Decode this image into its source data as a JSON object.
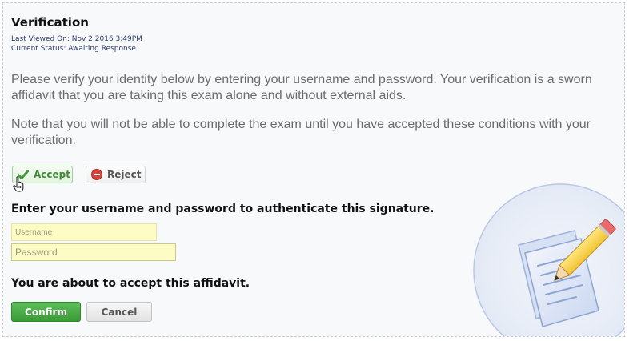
{
  "verification": {
    "title": "Verification",
    "last_viewed": "Last Viewed On: Nov 2 2016 3:49PM",
    "status": "Current Status: Awaiting Response",
    "paragraph1": "Please verify your identity below by entering your username and password. Your verification is a sworn affidavit that you are taking this exam alone and without external aids.",
    "paragraph2": "Note that you will not be able to complete the exam until you have accepted these conditions with your verification."
  },
  "decision": {
    "accept_label": "Accept",
    "reject_label": "Reject"
  },
  "auth": {
    "instruction": "Enter your username and password to authenticate this signature.",
    "username_placeholder": "Username",
    "password_placeholder": "Password",
    "confirmation_text": "You are about to accept this affidavit.",
    "confirm_label": "Confirm",
    "cancel_label": "Cancel"
  },
  "icons": {
    "accept": "checkmark-icon",
    "reject": "minus-circle-icon",
    "cursor": "hand-pointer-icon",
    "illustration": "document-pencil-icon"
  },
  "colors": {
    "accept_green": "#3f8a38",
    "confirm_green": "#3a9a36",
    "reject_red": "#d9453d",
    "field_yellow": "#fcfcc4"
  }
}
